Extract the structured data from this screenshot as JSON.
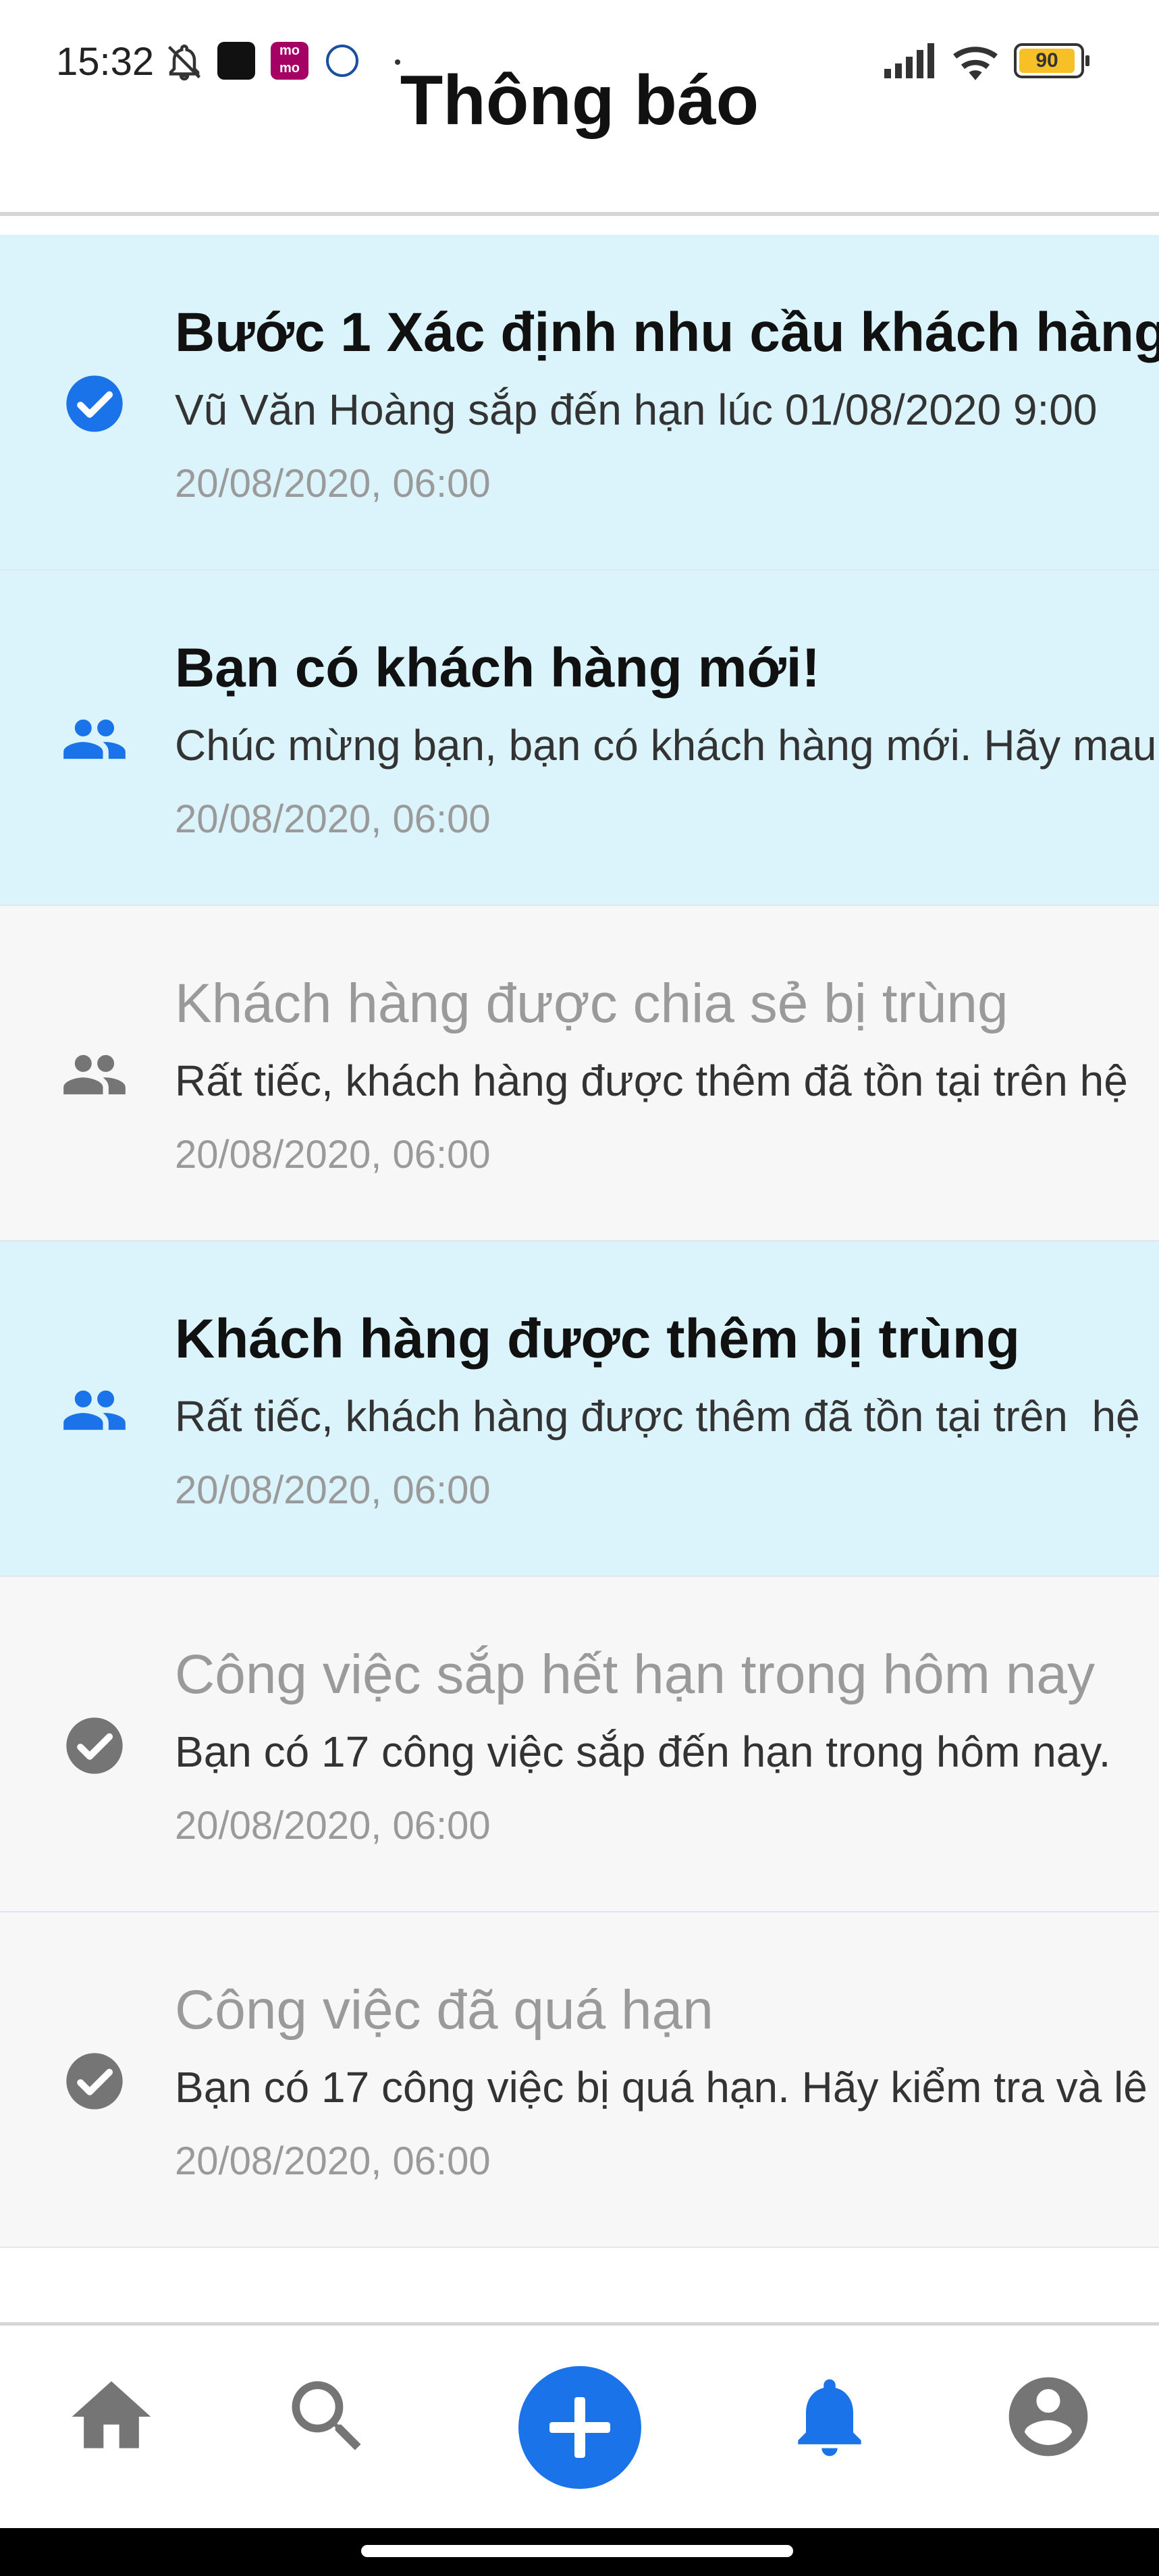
{
  "status_bar": {
    "time": "15:32",
    "battery": "90",
    "icons": [
      "bell-off-icon",
      "app-icon",
      "momo-icon",
      "app-icon",
      "signal-icon",
      "wifi-icon",
      "battery-icon"
    ]
  },
  "header": {
    "title": "Thông báo"
  },
  "notifications": [
    {
      "title": "Bước 1 Xác định nhu cầu khách hàng",
      "message": "Vũ Văn Hoàng sắp đến hạn lúc 01/08/2020 9:00",
      "time": "20/08/2020, 06:00",
      "icon": "check-circle-icon",
      "status": "unread"
    },
    {
      "title": "Bạn có khách hàng mới!",
      "message": "Chúc mừng bạn, bạn có khách hàng mới. Hãy mau",
      "time": "20/08/2020, 06:00",
      "icon": "people-icon",
      "status": "unread"
    },
    {
      "title": "Khách hàng được chia sẻ bị trùng",
      "message": "Rất tiếc, khách hàng được thêm đã tồn tại trên hệ",
      "time": "20/08/2020, 06:00",
      "icon": "people-icon",
      "status": "read"
    },
    {
      "title": "Khách hàng được thêm bị trùng",
      "message": "Rất tiếc, khách hàng được thêm đã tồn tại trên  hệ",
      "time": "20/08/2020, 06:00",
      "icon": "people-icon",
      "status": "unread"
    },
    {
      "title": "Công việc sắp hết hạn trong hôm nay",
      "message": "Bạn có 17 công việc sắp đến hạn trong hôm nay.",
      "time": "20/08/2020, 06:00",
      "icon": "check-circle-icon",
      "status": "read"
    },
    {
      "title": "Công việc đã quá hạn",
      "message": "Bạn có 17 công việc bị quá hạn. Hãy kiểm tra và lê",
      "time": "20/08/2020, 06:00",
      "icon": "check-circle-icon",
      "status": "read"
    }
  ],
  "bottom_nav": {
    "items": [
      "home-icon",
      "search-icon",
      "add-icon",
      "bell-icon",
      "account-icon"
    ],
    "active": "bell-icon"
  },
  "colors": {
    "accent": "#1a73e8",
    "unread_bg": "#dbf3fb",
    "read_bg": "#f7f7f7",
    "muted_icon": "#757575",
    "muted_text": "#9a9a9a"
  }
}
